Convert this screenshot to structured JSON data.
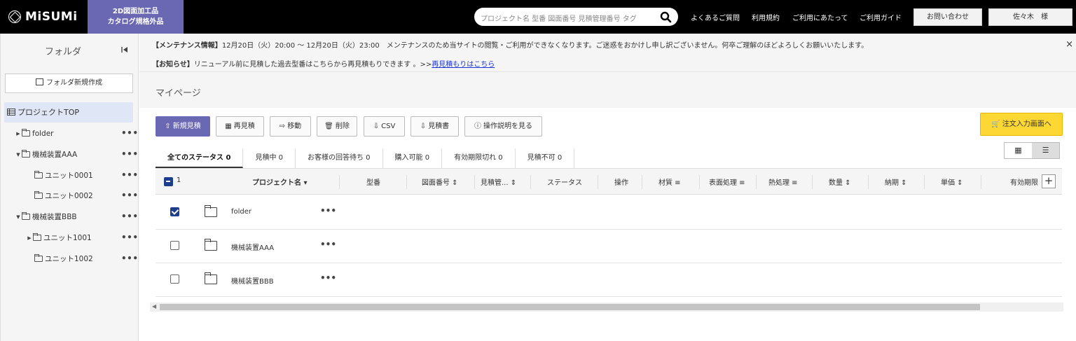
{
  "header": {
    "logo": "MiSUMi",
    "promo_line1": "2D図面加工品",
    "promo_line2": "カタログ規格外品",
    "search_placeholder": "プロジェクト名  型番  図面番号  見積管理番号  タグ",
    "nav": [
      "よくあるご質問",
      "利用規約",
      "ご利用にあたって",
      "ご利用ガイド"
    ],
    "contact_button": "お問い合わせ",
    "user_button": "佐々木　様"
  },
  "sidebar": {
    "title": "フォルダ",
    "new_folder": "フォルダ新規作成",
    "top_item": "プロジェクトTOP",
    "tree": [
      {
        "label": "folder",
        "level": 1,
        "caret": "right"
      },
      {
        "label": "機械装置AAA",
        "level": 1,
        "caret": "down"
      },
      {
        "label": "ユニット0001",
        "level": 2,
        "caret": ""
      },
      {
        "label": "ユニット0002",
        "level": 2,
        "caret": ""
      },
      {
        "label": "機械装置BBB",
        "level": 1,
        "caret": "down"
      },
      {
        "label": "ユニット1001",
        "level": 2,
        "caret": "right"
      },
      {
        "label": "ユニット1002",
        "level": 2,
        "caret": ""
      }
    ],
    "more": "•••"
  },
  "notices": {
    "maintenance_tag": "【メンテナンス情報】",
    "maintenance_text": "12月20日（火）20:00 ～ 12月20日（火）23:00　メンテナンスのため当サイトの閲覧・ご利用ができなくなります。ご迷惑をおかけし申し訳ございません。何卒ご理解のほどよろしくお願いいたします。",
    "info_tag": "【お知らせ】",
    "info_text": "リニューアル前に見積した過去型番はこちらから再見積もりできます 。>>",
    "info_link": "再見積もりはこちら",
    "close": "×"
  },
  "page_title": "マイページ",
  "toolbar": {
    "buttons": [
      "新規見積",
      "再見積",
      "移動",
      "削除",
      "CSV",
      "見積書",
      "操作説明を見る"
    ],
    "order_button": "注文入力画面へ"
  },
  "tabs": [
    "全てのステータス 0",
    "見積中 0",
    "お客様の回答待ち 0",
    "購入可能 0",
    "有効期限切れ 0",
    "見積不可 0"
  ],
  "table": {
    "selected_count": "1",
    "columns": [
      "プロジェクト名 ▾",
      "型番",
      "図面番号 ⇕",
      "見積管... ⇕",
      "ステータス",
      "操作",
      "材質 ≡",
      "表面処理 ≡",
      "熱処理 ≡",
      "数量 ⇕",
      "納期 ⇕",
      "単価 ⇕",
      "有効期限"
    ],
    "add_column": "+",
    "rows": [
      {
        "name": "folder",
        "checked": true
      },
      {
        "name": "機械装置AAA",
        "checked": false
      },
      {
        "name": "機械装置BBB",
        "checked": false
      }
    ],
    "more": "•••"
  }
}
